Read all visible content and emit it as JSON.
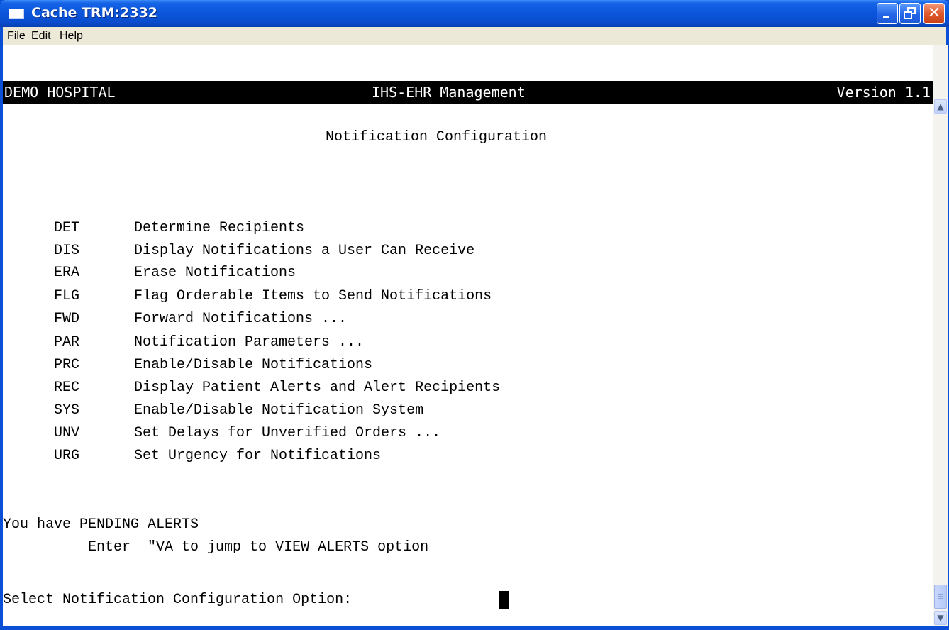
{
  "window": {
    "title": "Cache TRM:2332",
    "controls": [
      "minimize-icon",
      "restore-icon",
      "close-icon"
    ]
  },
  "menu": {
    "file": "File",
    "edit": "Edit",
    "help": "Help"
  },
  "terminal": {
    "status": {
      "left": "DEMO HOSPITAL",
      "center": "IHS-EHR Management",
      "right": "Version 1.1"
    },
    "screen_title": "Notification Configuration",
    "options": [
      {
        "code": "DET",
        "label": "Determine Recipients"
      },
      {
        "code": "DIS",
        "label": "Display Notifications a User Can Receive"
      },
      {
        "code": "ERA",
        "label": "Erase Notifications"
      },
      {
        "code": "FLG",
        "label": "Flag Orderable Items to Send Notifications"
      },
      {
        "code": "FWD",
        "label": "Forward Notifications ..."
      },
      {
        "code": "PAR",
        "label": "Notification Parameters ..."
      },
      {
        "code": "PRC",
        "label": "Enable/Disable Notifications"
      },
      {
        "code": "REC",
        "label": "Display Patient Alerts and Alert Recipients"
      },
      {
        "code": "SYS",
        "label": "Enable/Disable Notification System"
      },
      {
        "code": "UNV",
        "label": "Set Delays for Unverified Orders ..."
      },
      {
        "code": "URG",
        "label": "Set Urgency for Notifications"
      }
    ],
    "alerts_line": "You have PENDING ALERTS",
    "alerts_hint": "          Enter  \"VA to jump to VIEW ALERTS option",
    "prompt": "Select Notification Configuration Option:"
  },
  "colors": {
    "titlebar": "#0a55db",
    "terminal_bg": "#ffffff",
    "status_bg": "#000000",
    "close_button": "#e05a2e"
  }
}
